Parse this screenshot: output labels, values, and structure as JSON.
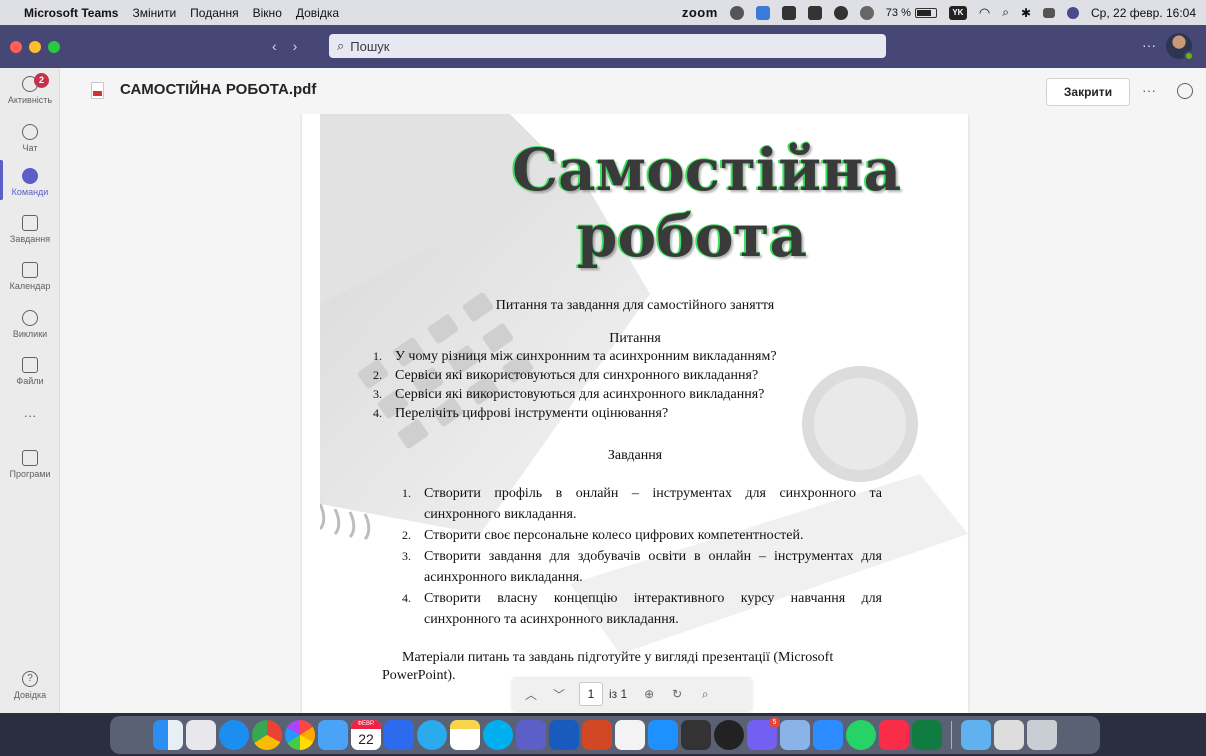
{
  "menubar": {
    "app": "Microsoft Teams",
    "menus": [
      "Змінити",
      "Подання",
      "Вікно",
      "Довідка"
    ],
    "zoom_label": "zoom",
    "battery": "73 %",
    "yk": "YK",
    "datetime": "Ср, 22 февр.  16:04"
  },
  "titlebar": {
    "search_placeholder": "Пошук",
    "more": "···"
  },
  "rail": {
    "activity_badge": "2",
    "items": [
      {
        "label": "Активність"
      },
      {
        "label": "Чат"
      },
      {
        "label": "Команди"
      },
      {
        "label": "Завдання"
      },
      {
        "label": "Календар"
      },
      {
        "label": "Виклики"
      },
      {
        "label": "Файли"
      }
    ],
    "more": "···",
    "apps": "Програми",
    "help": "Довідка"
  },
  "file": {
    "name": "САМОСТІЙНА РОБОТА.pdf",
    "close": "Закрити",
    "more": "···"
  },
  "document": {
    "title_line1": "Самостійна",
    "title_line2": "робота",
    "subtitle": "Питання та завдання для самостійного заняття",
    "questions_heading": "Питання",
    "questions": [
      {
        "n": "1.",
        "text": "У чому різниця між синхронним та асинхронним викладанням?"
      },
      {
        "n": "2.",
        "text": "Сервіси які використовуються для синхронного викладання?"
      },
      {
        "n": "3.",
        "text": "Сервіси які використовуються для асинхронного викладання?"
      },
      {
        "n": "4.",
        "text": "Перелічіть цифрові інструменти оцінювання?"
      }
    ],
    "tasks_heading": "Завдання",
    "tasks": [
      {
        "n": "1.",
        "text": "Створити профіль в онлайн – інструментах для синхронного та синхронного  викладання."
      },
      {
        "n": "2.",
        "text": "Створити своє персональне колесо цифрових компетентностей."
      },
      {
        "n": "3.",
        "text": "Створити завдання для здобувачів освіти в онлайн – інструментах для асинхронного викладання."
      },
      {
        "n": "4.",
        "text": "Створити власну концепцію інтерактивного курсу навчання для синхронного та  асинхронного викладання."
      }
    ],
    "footer_line1": "Матеріали питань та завдань підготуйте у вигляді презентації (Microsoft",
    "footer_line2": "PowerPoint)."
  },
  "pdf_toolbar": {
    "page": "1",
    "of": "із 1"
  },
  "dock": {
    "calendar_month": "ФЕВР.",
    "calendar_day": "22",
    "viber_badge": "5"
  },
  "colors": {
    "teams_purple": "#464775",
    "accent": "#5b5fc7",
    "badge_red": "#c4314b",
    "title_green": "#3ce25a"
  }
}
